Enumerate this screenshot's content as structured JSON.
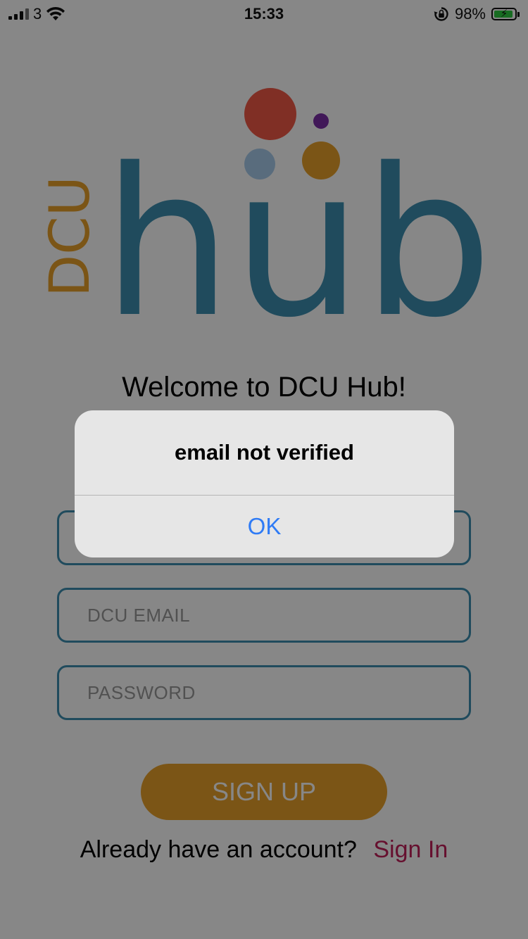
{
  "status_bar": {
    "carrier": "3",
    "time": "15:33",
    "battery_percent": "98%"
  },
  "logo": {
    "vertical_text": "DCU",
    "main_text": "hub"
  },
  "welcome": "Welcome to DCU Hub!",
  "form": {
    "name_placeholder": "",
    "email_placeholder": "DCU EMAIL",
    "password_placeholder": "PASSWORD"
  },
  "signup_label": "SIGN UP",
  "signin": {
    "prompt": "Already have an account?",
    "link": "Sign In"
  },
  "alert": {
    "title": "email not verified",
    "ok_label": "OK"
  },
  "colors": {
    "hub_teal": "#3d8fb0",
    "dcu_orange": "#e9a12a",
    "dot_red": "#f25a47",
    "dot_purple": "#7b2ea6",
    "dot_blue": "#a9cdec",
    "link_magenta": "#c11f5a",
    "alert_blue": "#2f7bf5"
  }
}
